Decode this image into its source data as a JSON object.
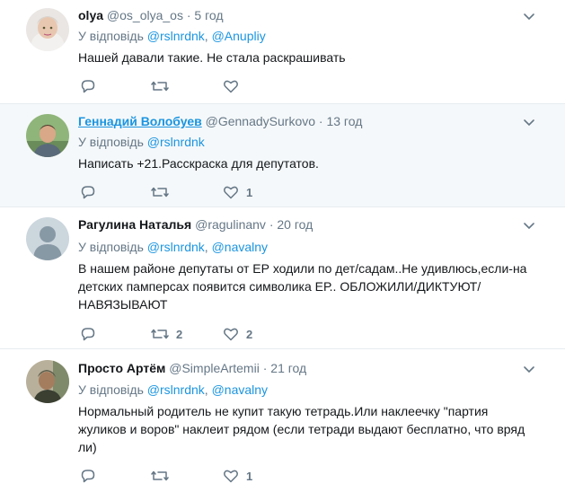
{
  "reply_prefix": "У відповідь",
  "tweets": [
    {
      "name": "olya",
      "handle": "@os_olya_os",
      "separator": "·",
      "time": "5 год",
      "mentions": [
        "@rslnrdnk",
        "@Anupliy"
      ],
      "mention_sep": ",",
      "text": "Нашей давали такие. Не стала раскрашивать",
      "retweets": "",
      "likes": ""
    },
    {
      "name": "Геннадий Волобуев",
      "handle": "@GennadySurkovo",
      "separator": "·",
      "time": "13 год",
      "mentions": [
        "@rslnrdnk"
      ],
      "text": "Написать +21.Расскраска для депутатов.",
      "retweets": "",
      "likes": "1"
    },
    {
      "name": "Рагулина Наталья",
      "handle": "@ragulinanv",
      "separator": "·",
      "time": "20 год",
      "mentions": [
        "@rslnrdnk",
        "@navalny"
      ],
      "mention_sep": ",",
      "text_lines": [
        "В нашем районе депутаты от ЕР ходили по дет/садам..Не удивлюсь,если-на",
        "детских памперсах появится символика ЕР.. ОБЛОЖИЛИ/ДИКТУЮТ/",
        "НАВЯЗЫВАЮТ"
      ],
      "retweets": "2",
      "likes": "2"
    },
    {
      "name": "Просто Артём",
      "handle": "@SimpleArtemii",
      "separator": "·",
      "time": "21 год",
      "mentions": [
        "@rslnrdnk",
        "@navalny"
      ],
      "mention_sep": ",",
      "text_lines": [
        "Нормальный родитель не купит такую тетрадь.Или наклеечку \"партия",
        "жуликов и воров\" наклеит рядом (если тетради выдают бесплатно, что вряд",
        "ли)"
      ],
      "retweets": "",
      "likes": "1"
    }
  ],
  "colors": {
    "accent": "#1b95e0",
    "muted": "#657786",
    "border": "#e6ecf0",
    "highlight": "#f5f8fa"
  },
  "icons": [
    "reply-icon",
    "retweet-icon",
    "like-icon",
    "caret-down-icon"
  ]
}
